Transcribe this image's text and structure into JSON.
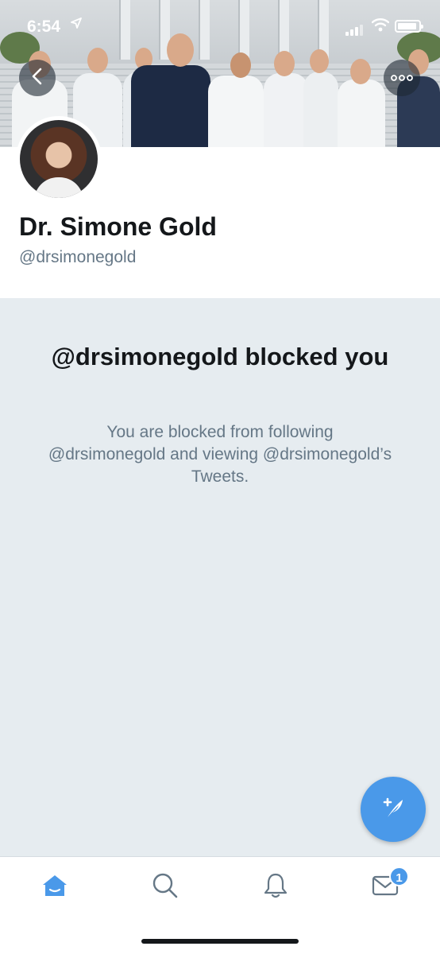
{
  "status_bar": {
    "time": "6:54",
    "location_icon": "location-arrow-icon",
    "signal_icon": "cellular-signal-icon",
    "wifi_icon": "wifi-icon",
    "battery_icon": "battery-icon"
  },
  "header": {
    "back_icon": "chevron-left-icon",
    "more_icon": "more-horizontal-icon"
  },
  "profile": {
    "name": "Dr. Simone Gold",
    "handle": "@drsimonegold"
  },
  "blocked": {
    "title": "@drsimonegold blocked you",
    "description": "You are blocked from following @drsimonegold and viewing @drsimonegold’s Tweets."
  },
  "fab": {
    "icon": "compose-tweet-icon"
  },
  "tabbar": {
    "items": [
      {
        "icon": "home-icon",
        "active": true
      },
      {
        "icon": "search-icon",
        "active": false
      },
      {
        "icon": "bell-icon",
        "active": false
      },
      {
        "icon": "mail-icon",
        "active": false
      }
    ],
    "messages_badge": "1"
  },
  "colors": {
    "accent": "#4a99e9",
    "background": "#e6ecf0",
    "text_primary": "#14171a",
    "text_secondary": "#657786"
  }
}
